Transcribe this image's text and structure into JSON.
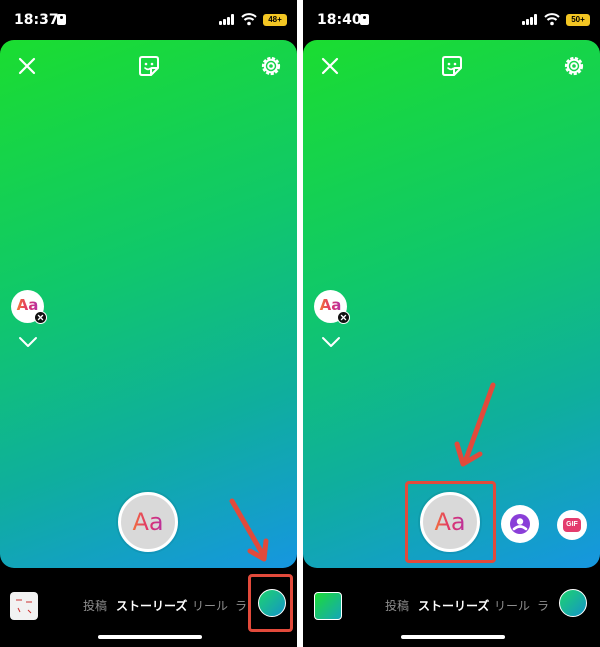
{
  "left": {
    "status": {
      "time": "18:37",
      "battery": "48+"
    },
    "text_sticker": "Aa",
    "create_button": "Aa",
    "modes": {
      "post": "投稿",
      "stories": "ストーリーズ",
      "reels": "リール",
      "live": "ラ"
    }
  },
  "right": {
    "status": {
      "time": "18:40",
      "battery": "50+"
    },
    "text_sticker": "Aa",
    "create_button": "Aa",
    "gif_label": "GIF",
    "modes": {
      "post": "投稿",
      "stories": "ストーリーズ",
      "reels": "リール",
      "live": "ラ"
    }
  },
  "colors": {
    "gradient_top": "#1bdd30",
    "gradient_bottom": "#1696e0",
    "highlight": "#e24a3b"
  },
  "icons": [
    "close-icon",
    "sticker-icon",
    "gear-icon",
    "chevron-down-icon",
    "person-icon",
    "gif-icon"
  ]
}
